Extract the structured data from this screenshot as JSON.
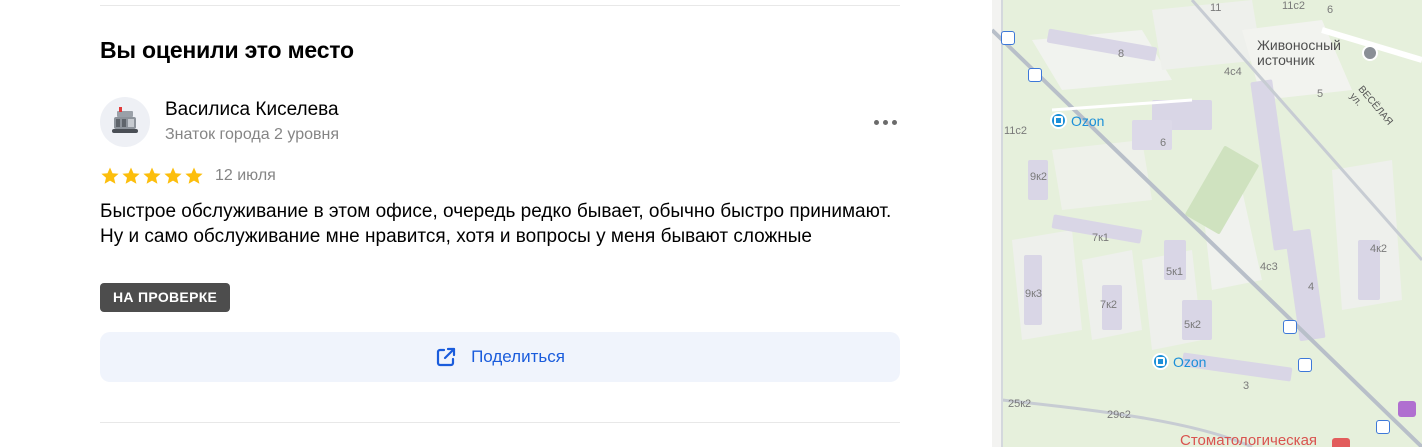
{
  "section": {
    "title": "Вы оценили это место"
  },
  "review": {
    "author_name": "Василиса Киселева",
    "author_level": "Знаток города 2 уровня",
    "rating": 5,
    "rating_max": 5,
    "date": "12 июля",
    "text": "Быстрое обслуживание в этом офисе, очередь редко бывает, обычно быстро принимают. Ну и само обслуживание мне нравится, хотя и вопросы у меня бывают сложные",
    "status_badge": "НА ПРОВЕРКЕ",
    "more_icon": "more-dots-icon"
  },
  "share": {
    "label": "Поделиться",
    "icon": "share-icon"
  },
  "colors": {
    "star": "#fcbe0c",
    "share_text": "#1a5cdc",
    "share_bg": "#f0f4fc",
    "badge_bg": "#4d4d4d",
    "muted_text": "#858585"
  },
  "map": {
    "labels": {
      "b11": "11",
      "b11c2_top": "11с2",
      "b6_top": "6",
      "b8": "8",
      "b4c4": "4с4",
      "b5": "5",
      "b11c2": "11с2",
      "b6": "6",
      "b9k2": "9к2",
      "b7k1": "7к1",
      "b4k2": "4к2",
      "b5k1": "5к1",
      "b4c3": "4с3",
      "b9k3": "9к3",
      "b7k2": "7к2",
      "b4": "4",
      "b5k2": "5к2",
      "b3": "3",
      "b25k2": "25к2",
      "b29c2": "29с2"
    },
    "place": "Живоносный\nисточник",
    "street": "ВЕСЁЛАЯ ул.",
    "ozon_1": "Ozon",
    "ozon_2": "Ozon",
    "dental": "Стоматологическая"
  }
}
